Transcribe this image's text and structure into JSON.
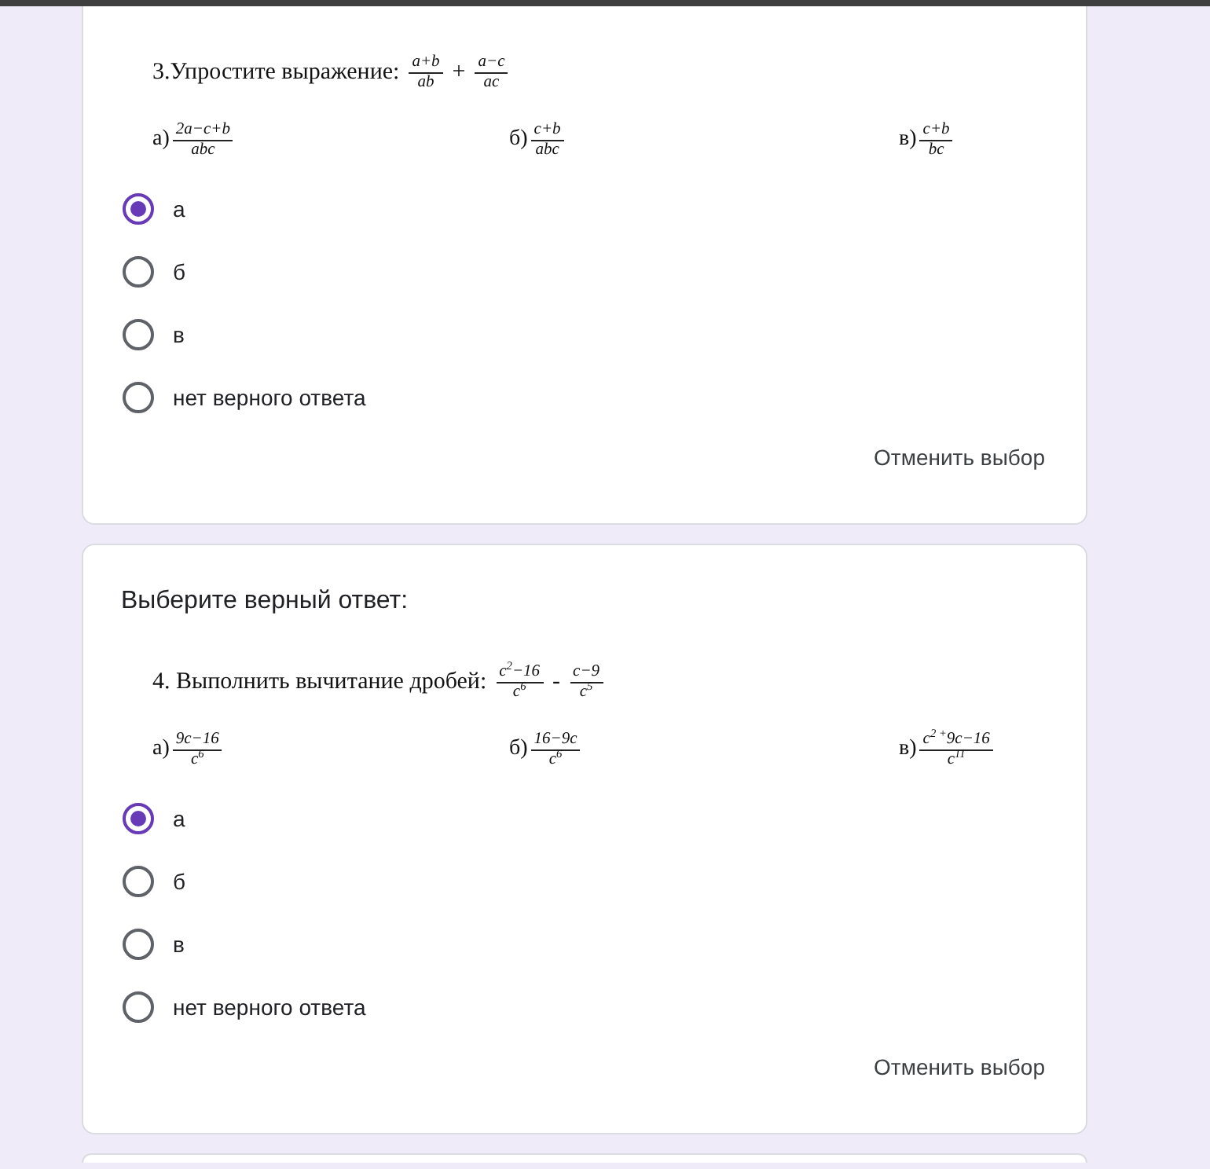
{
  "questions": [
    {
      "problem": {
        "text": "3.Упростите выражение:",
        "expression": [
          {
            "kind": "fraction",
            "numerator": "a+b",
            "denominator": "ab"
          },
          {
            "kind": "operator",
            "text": "+"
          },
          {
            "kind": "fraction",
            "numerator": "a−c",
            "denominator": "ac"
          }
        ]
      },
      "answers": [
        {
          "label": "а)",
          "numerator": "2a−c+b",
          "denominator": "abc"
        },
        {
          "label": "б)",
          "numerator": "c+b",
          "denominator": "abc"
        },
        {
          "label": "в)",
          "numerator": "c+b",
          "denominator": "bc"
        }
      ],
      "options": [
        {
          "label": "а",
          "selected": true
        },
        {
          "label": "б",
          "selected": false
        },
        {
          "label": "в",
          "selected": false
        },
        {
          "label": "нет верного ответа",
          "selected": false
        }
      ],
      "clear_button": "Отменить выбор"
    },
    {
      "title": "Выберите верный ответ:",
      "problem": {
        "text": "4. Выполнить вычитание дробей:",
        "expression": [
          {
            "kind": "fraction",
            "numerator": "c$^{2}$−16",
            "denominator": "c$^{6}$"
          },
          {
            "kind": "operator",
            "text": "-"
          },
          {
            "kind": "fraction",
            "numerator": "c−9",
            "denominator": "c$^{5}$"
          }
        ]
      },
      "answers": [
        {
          "label": "а)",
          "numerator": "9c−16",
          "denominator": "c$^{6}$"
        },
        {
          "label": "б)",
          "numerator": "16−9c",
          "denominator": "c$^{6}$"
        },
        {
          "label": "в)",
          "numerator": "c$^{2 +}$9c−16",
          "denominator": "c$^{11}$"
        }
      ],
      "options": [
        {
          "label": "а",
          "selected": true
        },
        {
          "label": "б",
          "selected": false
        },
        {
          "label": "в",
          "selected": false
        },
        {
          "label": "нет верного ответа",
          "selected": false
        }
      ],
      "clear_button": "Отменить выбор"
    }
  ]
}
